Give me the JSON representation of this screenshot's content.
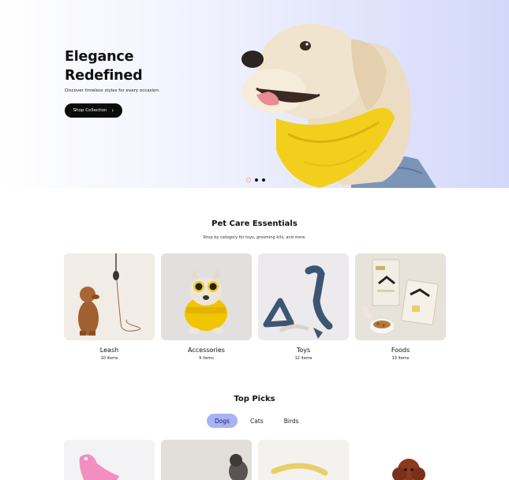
{
  "hero": {
    "title_line1": "Elegance",
    "title_line2": "Redefined",
    "subtitle": "Discover timeless styles for every occasion.",
    "button_label": "Shop Collection",
    "button_icon": "chevron-right-icon",
    "slides": [
      {
        "active": true
      },
      {
        "active": false
      },
      {
        "active": false
      }
    ]
  },
  "categories_section": {
    "title": "Pet Care Essentials",
    "subtitle": "Shop by category for toys, grooming kits, and more.",
    "items": [
      {
        "name": "Leash",
        "count": "10 items"
      },
      {
        "name": "Accessories",
        "count": "9 items"
      },
      {
        "name": "Toys",
        "count": "12 items"
      },
      {
        "name": "Foods",
        "count": "13 items"
      }
    ]
  },
  "top_picks": {
    "title": "Top Picks",
    "tabs": [
      {
        "label": "Dogs",
        "active": true
      },
      {
        "label": "Cats",
        "active": false
      },
      {
        "label": "Birds",
        "active": false
      }
    ]
  },
  "colors": {
    "accent": "#a8b3f5",
    "button_dark": "#0b0b0b",
    "scarf_yellow": "#f2cf1c"
  }
}
